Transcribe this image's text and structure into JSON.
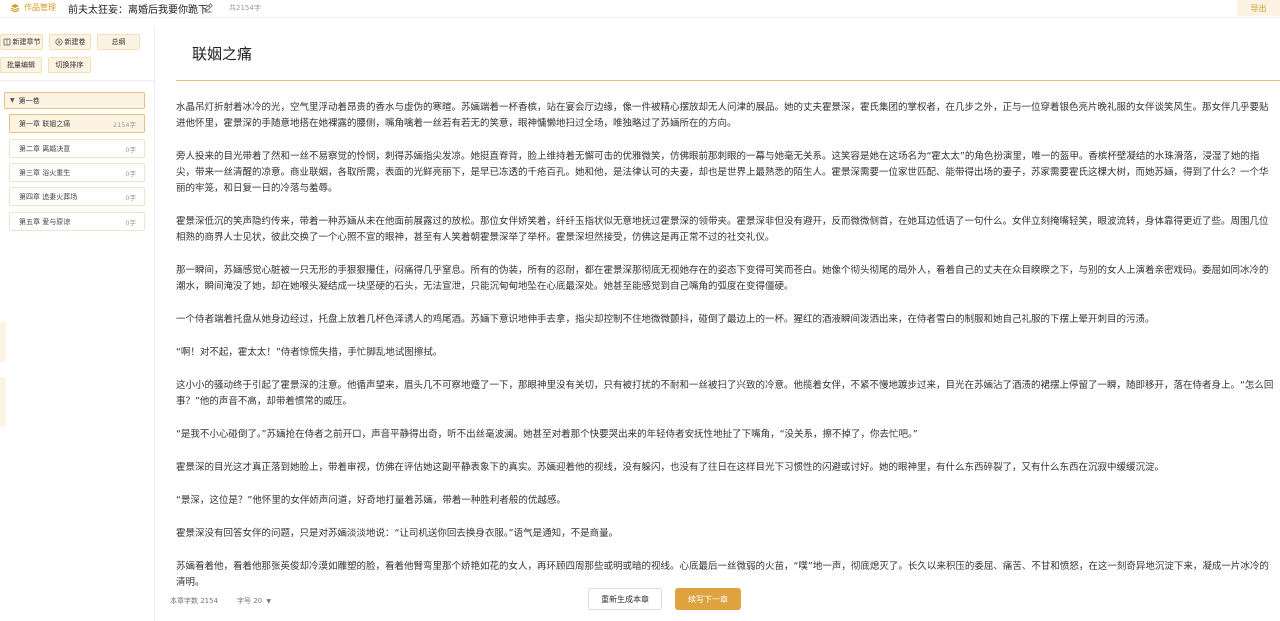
{
  "header": {
    "brand_label": "作品管理",
    "title": "前夫太狂妄：离婚后我要你跪下求",
    "word_count": "共2154字",
    "export_label": "导出",
    "colors": {
      "accent": "#d39b2a",
      "accent_bg": "#fdf3e2"
    }
  },
  "sidebar": {
    "buttons": {
      "new_chapter": "新建章节",
      "new_volume": "新建卷",
      "outline": "总纲",
      "batch_edit": "批量编辑",
      "toggle_sort": "切换排序"
    },
    "volume_label": "第一卷",
    "chapters": [
      {
        "title": "第一章 联姻之痛",
        "words": "2154字"
      },
      {
        "title": "第二章 离婚决意",
        "words": "0字"
      },
      {
        "title": "第三章 浴火重生",
        "words": "0字"
      },
      {
        "title": "第四章 追妻火葬场",
        "words": "0字"
      },
      {
        "title": "第五章 爱与原谅",
        "words": "0字"
      }
    ]
  },
  "editor": {
    "chapter_title": "联姻之痛",
    "paragraphs": [
      "水晶吊灯折射着冰冷的光，空气里浮动着昂贵的香水与虚伪的寒暄。苏婳端着一杯香槟，站在宴会厅边缘，像一件被精心摆放却无人问津的展品。她的丈夫霍景深，霍氏集团的掌权者，在几步之外，正与一位穿着银色亮片晚礼服的女伴谈笑风生。那女伴几乎要贴进他怀里，霍景深的手随意地搭在她裸露的腰侧，嘴角噙着一丝若有若无的笑意，眼神慵懒地扫过全场，唯独略过了苏婳所在的方向。",
      "旁人投来的目光带着了然和一丝不易察觉的怜悯，刺得苏婳指尖发凉。她挺直脊背，脸上维持着无懈可击的优雅微笑，仿佛眼前那刺眼的一幕与她毫无关系。这笑容是她在这场名为“霍太太”的角色扮演里，唯一的盔甲。香槟杯壁凝结的水珠滑落，浸湿了她的指尖，带来一丝清醒的凉意。商业联姻，各取所需，表面的光鲜亮丽下，是早已冻透的千疮百孔。她和他，是法律认可的夫妻，却也是世界上最熟悉的陌生人。霍景深需要一位家世匹配、能带得出场的妻子，苏家需要霍氏这棵大树，而她苏婳，得到了什么？一个华丽的牢笼，和日复一日的冷落与羞辱。",
      "霍景深低沉的笑声隐约传来，带着一种苏婳从未在他面前展露过的放松。那位女伴娇笑着，纤纤玉指状似无意地抚过霍景深的领带夹。霍景深非但没有避开，反而微微侧首，在她耳边低语了一句什么。女伴立刻掩嘴轻笑，眼波流转，身体靠得更近了些。周围几位相熟的商界人士见状，彼此交换了一个心照不宣的眼神，甚至有人笑着朝霍景深举了举杯。霍景深坦然接受，仿佛这是再正常不过的社交礼仪。",
      "那一瞬间，苏婳感觉心脏被一只无形的手狠狠攥住，闷痛得几乎窒息。所有的伪装，所有的忍耐，都在霍景深那彻底无视她存在的姿态下变得可笑而苍白。她像个彻头彻尾的局外人，看着自己的丈夫在众目睽睽之下，与别的女人上演着亲密戏码。委屈如同冰冷的潮水，瞬间淹没了她，却在她喉头凝结成一块坚硬的石头，无法宣泄，只能沉甸甸地坠在心底最深处。她甚至能感觉到自己嘴角的弧度在变得僵硬。",
      "一个侍者端着托盘从她身边经过，托盘上放着几杯色泽诱人的鸡尾酒。苏婳下意识地伸手去拿，指尖却控制不住地微微颤抖，碰倒了最边上的一杯。猩红的酒液瞬间泼洒出来，在侍者雪白的制服和她自己礼服的下摆上晕开刺目的污渍。",
      "“啊！对不起，霍太太！”侍者惊慌失措，手忙脚乱地试图擦拭。",
      "这小小的骚动终于引起了霍景深的注意。他循声望来，眉头几不可察地蹙了一下，那眼神里没有关切，只有被打扰的不耐和一丝被扫了兴致的冷意。他揽着女伴，不紧不慢地踱步过来，目光在苏婳沾了酒渍的裙摆上停留了一瞬，随即移开，落在侍者身上。“怎么回事？”他的声音不高，却带着惯常的威压。",
      "“是我不小心碰倒了。”苏婳抢在侍者之前开口，声音平静得出奇，听不出丝毫波澜。她甚至对着那个快要哭出来的年轻侍者安抚性地扯了下嘴角，“没关系，擦不掉了，你去忙吧。”",
      "霍景深的目光这才真正落到她脸上，带着审视，仿佛在评估她这副平静表象下的真实。苏婳迎着他的视线，没有躲闪，也没有了往日在这样目光下习惯性的闪避或讨好。她的眼神里，有什么东西碎裂了，又有什么东西在沉寂中缓缓沉淀。",
      "“景深，这位是？”他怀里的女伴娇声问道，好奇地打量着苏婳，带着一种胜利者般的优越感。",
      "霍景深没有回答女伴的问题，只是对苏婳淡淡地说：“让司机送你回去换身衣服。”语气是通知，不是商量。",
      "苏婳看着他，看着他那张英俊却冷漠如雕塑的脸，看着他臂弯里那个娇艳如花的女人，再环顾四周那些或明或暗的视线。心底最后一丝微弱的火苗，“噗”地一声，彻底熄灭了。长久以来积压的委屈、痛苦、不甘和愤怒，在这一刻奇异地沉淀下来，凝成一片冰冷的清明。"
    ]
  },
  "footer": {
    "chapter_words": "本章字数 2154",
    "font_size": "字号 20",
    "regenerate_label": "重新生成本章",
    "continue_label": "续写下一章"
  }
}
